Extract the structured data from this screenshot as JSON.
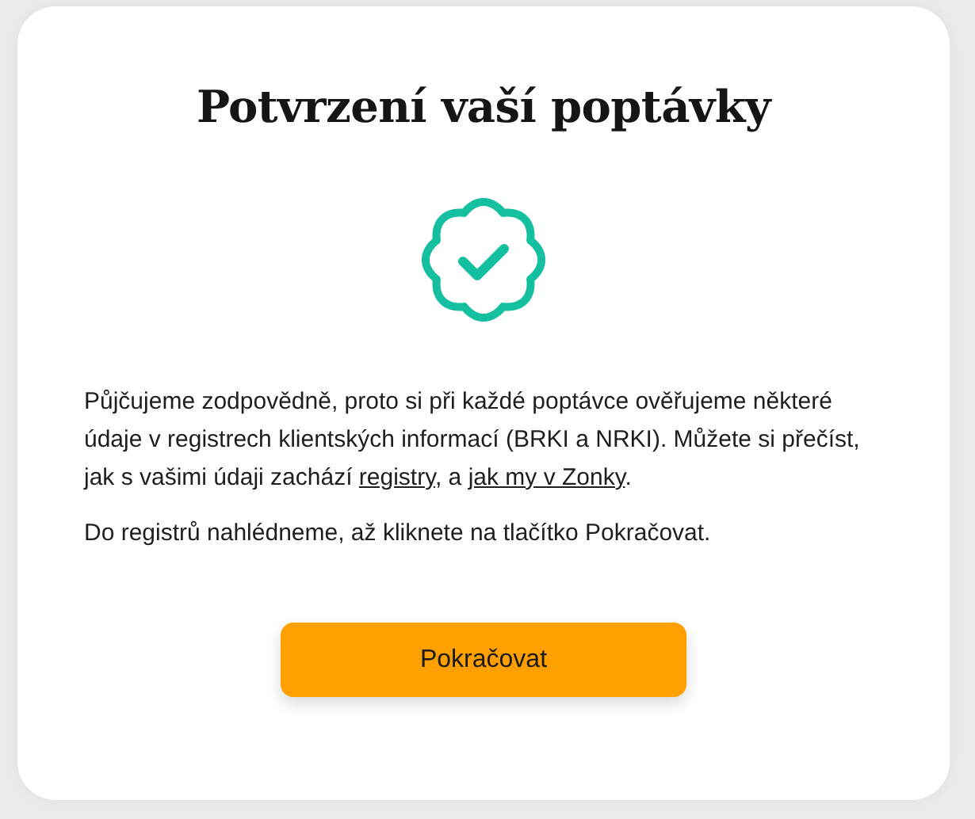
{
  "title": "Potvrzení vaší poptávky",
  "paragraphs": [
    {
      "parts": [
        {
          "kind": "text",
          "text": "Půjčujeme zodpovědně, proto si při každé poptávce ověřujeme některé údaje v registrech klientských informací (BRKI a NRKI). Můžete si přečíst, jak s vašimi údaji zachází "
        },
        {
          "kind": "link",
          "text": "registry"
        },
        {
          "kind": "text",
          "text": ", a "
        },
        {
          "kind": "link",
          "text": "jak my v Zonky"
        },
        {
          "kind": "text",
          "text": "."
        }
      ]
    },
    {
      "parts": [
        {
          "kind": "text",
          "text": "Do registrů nahlédneme, až kliknete na tlačítko Pokračovat."
        }
      ]
    }
  ],
  "button": "Pokračovat"
}
